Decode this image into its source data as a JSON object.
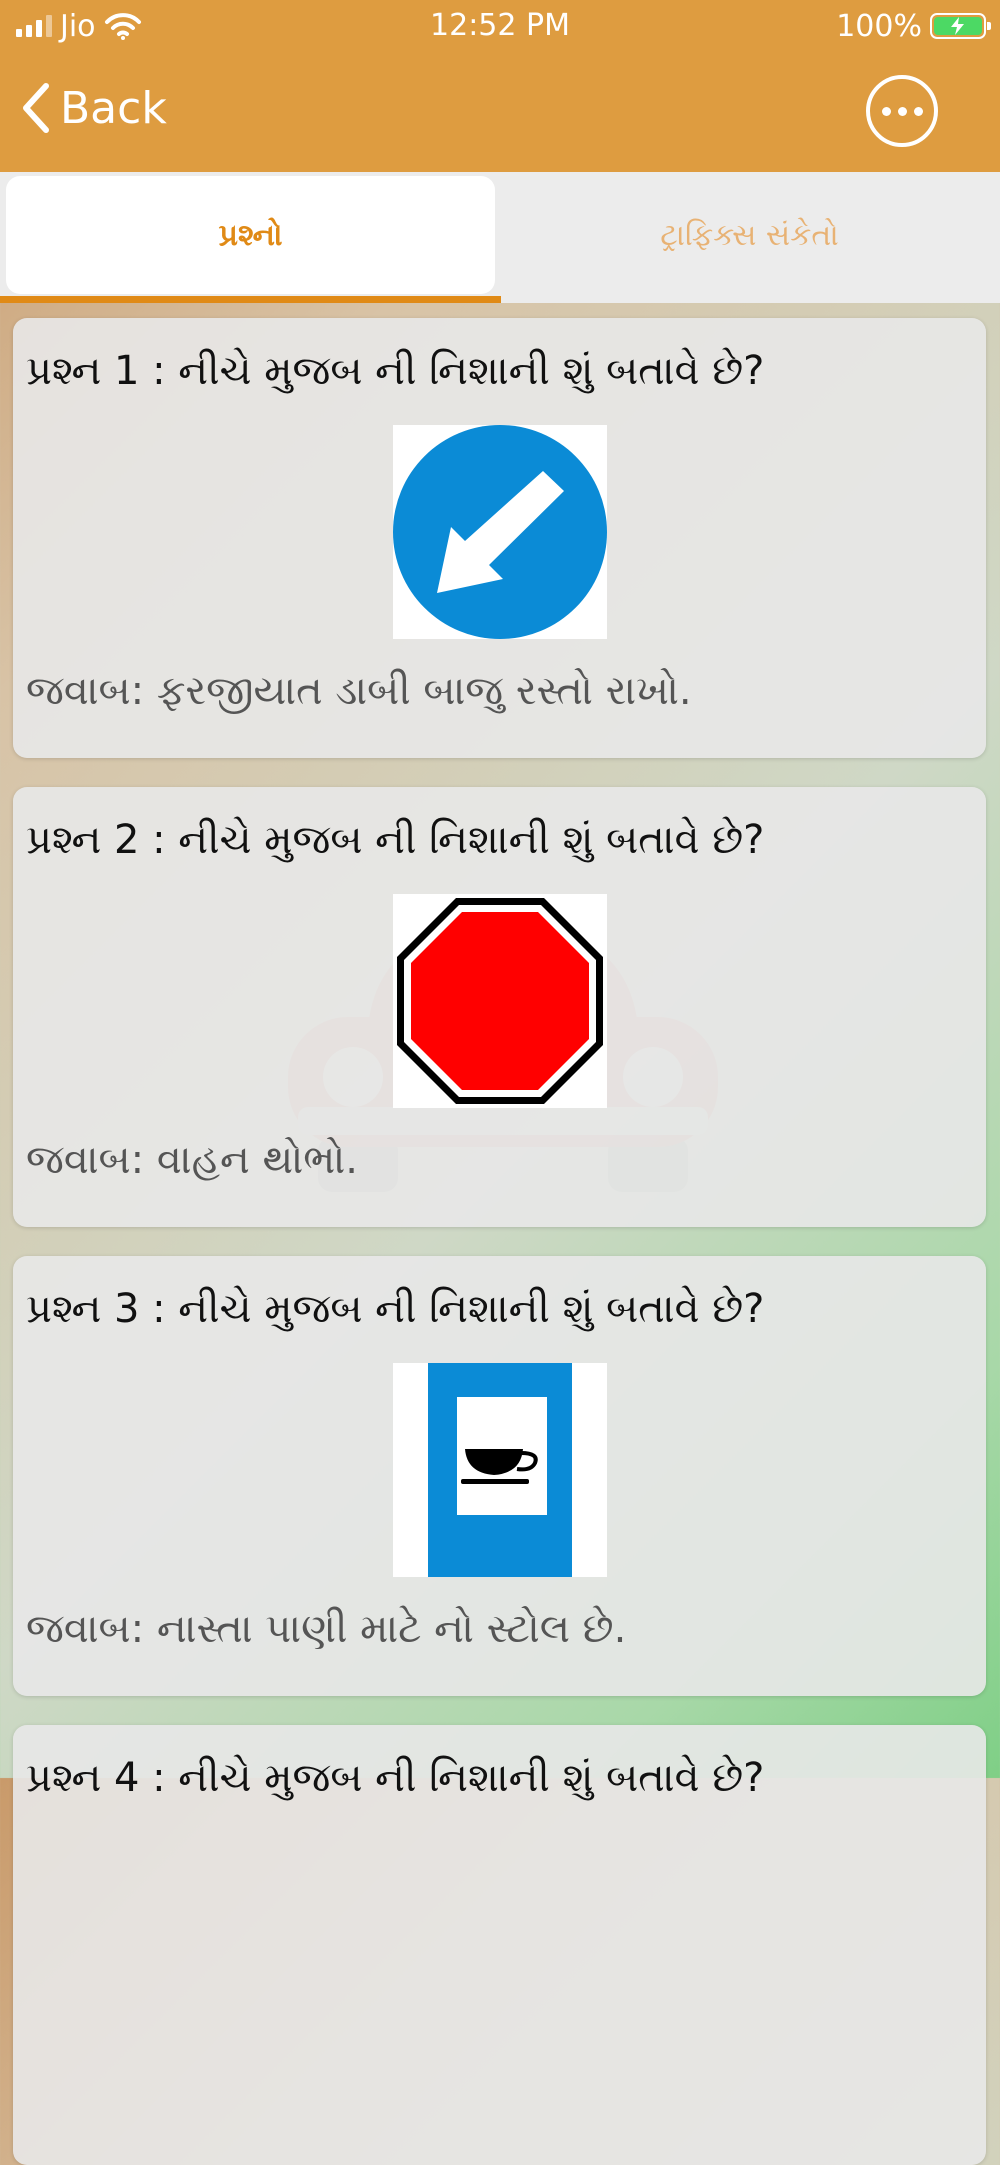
{
  "status_bar": {
    "carrier": "Jio",
    "time": "12:52 PM",
    "battery": "100%"
  },
  "nav": {
    "back_label": "Back",
    "more_icon": "more-horizontal-icon"
  },
  "tabs": [
    {
      "label": "પ્રશ્નો",
      "active": true
    },
    {
      "label": "ટ્રાફિક્સ સંકેતો",
      "active": false
    }
  ],
  "colors": {
    "accent": "#de9c40",
    "tab_active_text": "#e08a16",
    "tab_inactive_text": "#e8b274"
  },
  "questions": [
    {
      "question": "પ્રશ્ન 1 : નીચે મુજબ ની નિશાની શું બતાવે છે?",
      "sign_icon": "keep-left-sign-icon",
      "answer": "જવાબ: ફરજીયાત ડાબી બાજુ રસ્તો રાખો."
    },
    {
      "question": "પ્રશ્ન 2 : નીચે મુજબ ની નિશાની શું બતાવે છે?",
      "sign_icon": "stop-sign-icon",
      "answer": "જવાબ: વાહન થોભો."
    },
    {
      "question": "પ્રશ્ન 3 : નીચે મુજબ ની નિશાની શું બતાવે છે?",
      "sign_icon": "refreshment-stall-sign-icon",
      "answer": "જવાબ: નાસ્તા પાણી માટે નો સ્ટોલ છે."
    },
    {
      "question": "પ્રશ્ન 4 : નીચે મુજબ ની નિશાની શું બતાવે છે?"
    }
  ]
}
